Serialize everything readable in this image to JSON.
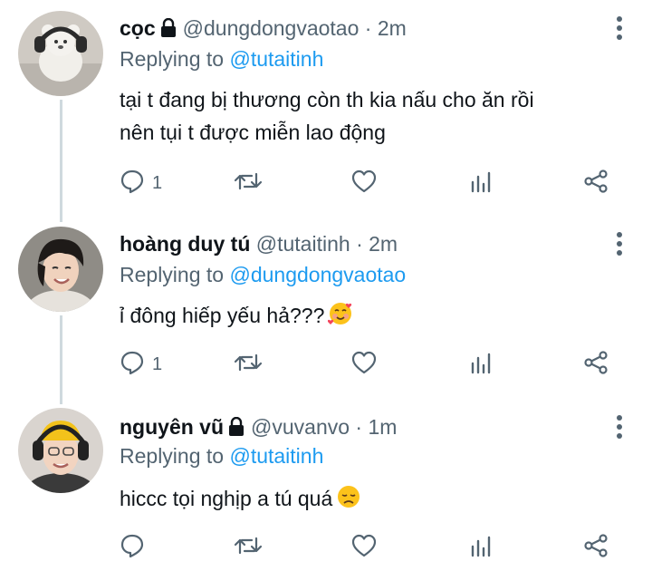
{
  "tweets": [
    {
      "name": "cọc",
      "locked": true,
      "handle": "@dungdongvaotao",
      "dot": "·",
      "time": "2m",
      "replying_prefix": "Replying to",
      "replying_to": "@tutaitinh",
      "text_lines": [
        "tại t đang bị thương còn th kia nấu cho ăn rồi",
        "nên tụi t được miễn lao động"
      ],
      "emoji": "",
      "reply_count": "1"
    },
    {
      "name": "hoàng duy tú",
      "locked": false,
      "handle": "@tutaitinh",
      "dot": "·",
      "time": "2m",
      "replying_prefix": "Replying to",
      "replying_to": "@dungdongvaotao",
      "text_lines": [
        "ỉ đông hiếp yếu hả???"
      ],
      "emoji": "smiling-face-with-hearts",
      "reply_count": "1"
    },
    {
      "name": "nguyên vũ",
      "locked": true,
      "handle": "@vuvanvo",
      "dot": "·",
      "time": "1m",
      "replying_prefix": "Replying to",
      "replying_to": "@tutaitinh",
      "text_lines": [
        "hiccc tọi nghịp a tú quá"
      ],
      "emoji": "disappointed-face",
      "reply_count": ""
    }
  ],
  "icons": {
    "reply": "reply-icon",
    "retweet": "retweet-icon",
    "like": "heart-icon",
    "views": "analytics-icon",
    "share": "share-icon",
    "more": "more-vertical-icon",
    "lock": "lock-icon"
  },
  "colors": {
    "text": "#0f1419",
    "secondary": "#536471",
    "link": "#1d9bf0",
    "thread": "#cfd9de"
  }
}
